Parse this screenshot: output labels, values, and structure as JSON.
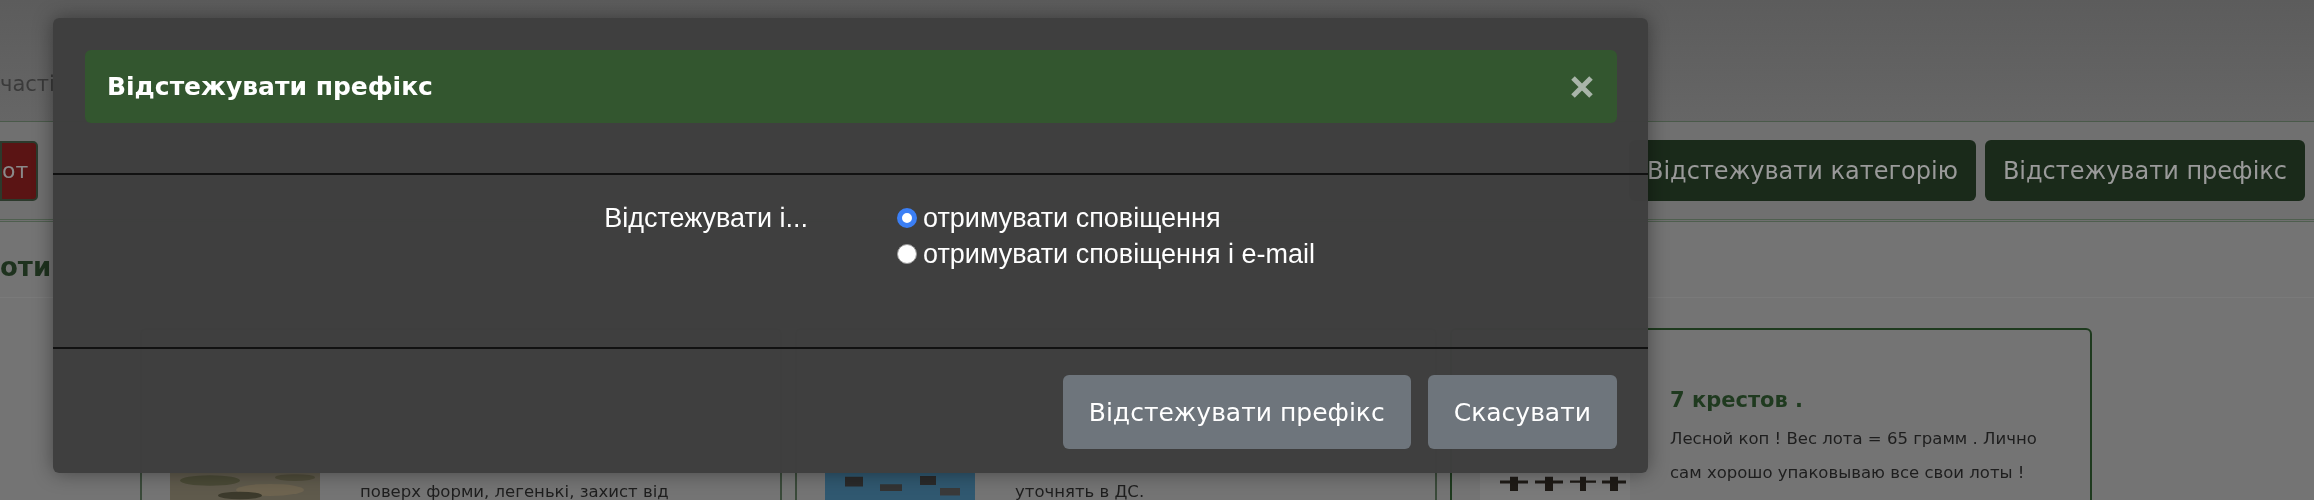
{
  "page": {
    "top_text": "часті",
    "alert_button": "от",
    "toolbar_buttons": [
      "Відстежувати категорію",
      "Відстежувати префікс"
    ],
    "section_heading": "оти",
    "cards": [
      {
        "description": "поверх форми, легенькі, захист від"
      },
      {
        "description": "уточнять в ДС."
      },
      {
        "title": "7 крестов .",
        "description": "Лесной коп ! Вес лота = 65 грамм . Лично сам хорошо упаковываю все свои лоты !"
      }
    ]
  },
  "dialog": {
    "title": "Відстежувати префікс",
    "prompt": "Відстежувати і...",
    "options": [
      {
        "label": "отримувати сповіщення",
        "selected": true
      },
      {
        "label": "отримувати сповіщення і e-mail",
        "selected": false
      }
    ],
    "buttons": [
      "Відстежувати префікс",
      "Скасувати"
    ]
  }
}
